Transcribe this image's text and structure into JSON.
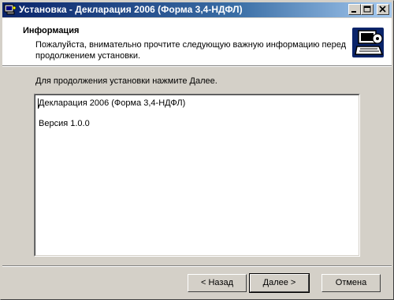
{
  "window": {
    "title": "Установка - Декларация 2006 (Форма 3,4-НДФЛ)",
    "titlebar_colors": [
      "#0a246a",
      "#a6caf0"
    ]
  },
  "header": {
    "title": "Информация",
    "description": "Пожалуйста, внимательно прочтите следующую важную информацию перед продолжением установки."
  },
  "body": {
    "prompt": "Для продолжения установки нажмите Далее.",
    "memo_lines": [
      "Декларация 2006 (Форма 3,4-НДФЛ)",
      "Версия 1.0.0"
    ]
  },
  "buttons": {
    "back": "< Назад",
    "next": "Далее >",
    "cancel": "Отмена"
  },
  "icons": {
    "title_icon": "setup-icon",
    "logo": "computer-install-icon"
  }
}
